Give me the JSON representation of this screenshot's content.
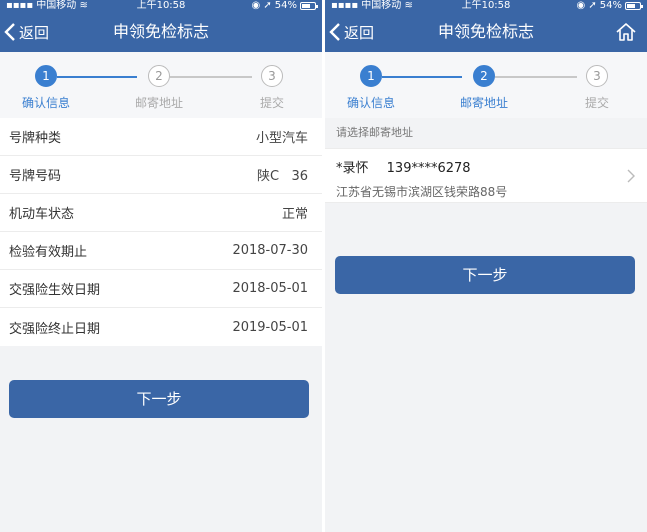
{
  "status_bar": {
    "carrier": "中国移动",
    "time": "上午10:58",
    "battery": "54%",
    "battery_level": 0.54
  },
  "left": {
    "nav": {
      "back_label": "返回",
      "title": "申领免检标志"
    },
    "steps": [
      {
        "number": "1",
        "label": "确认信息",
        "state": "active"
      },
      {
        "number": "2",
        "label": "邮寄地址",
        "state": "inactive"
      },
      {
        "number": "3",
        "label": "提交",
        "state": "inactive"
      }
    ],
    "info_rows": [
      {
        "label": "号牌种类",
        "value": "小型汽车"
      },
      {
        "label": "号牌号码",
        "value": "陕C   36"
      },
      {
        "label": "机动车状态",
        "value": "正常"
      },
      {
        "label": "检验有效期止",
        "value": "2018-07-30"
      },
      {
        "label": "交强险生效日期",
        "value": "2018-05-01"
      },
      {
        "label": "交强险终止日期",
        "value": "2019-05-01"
      }
    ],
    "next_button": "下一步"
  },
  "right": {
    "nav": {
      "back_label": "返回",
      "title": "申领免检标志",
      "home_icon": "home-icon"
    },
    "steps": [
      {
        "number": "1",
        "label": "确认信息",
        "state": "active"
      },
      {
        "number": "2",
        "label": "邮寄地址",
        "state": "active"
      },
      {
        "number": "3",
        "label": "提交",
        "state": "inactive"
      }
    ],
    "address_hint": "请选择邮寄地址",
    "address": {
      "name": "*录怀",
      "phone": "139****6278",
      "detail": "江苏省无锡市滨湖区钱荣路88号"
    },
    "next_button": "下一步"
  },
  "colors": {
    "brand": "#3a66a6",
    "step_active": "#3a7fd0",
    "step_inactive": "#bbbbbb",
    "background": "#f2f3f5"
  }
}
